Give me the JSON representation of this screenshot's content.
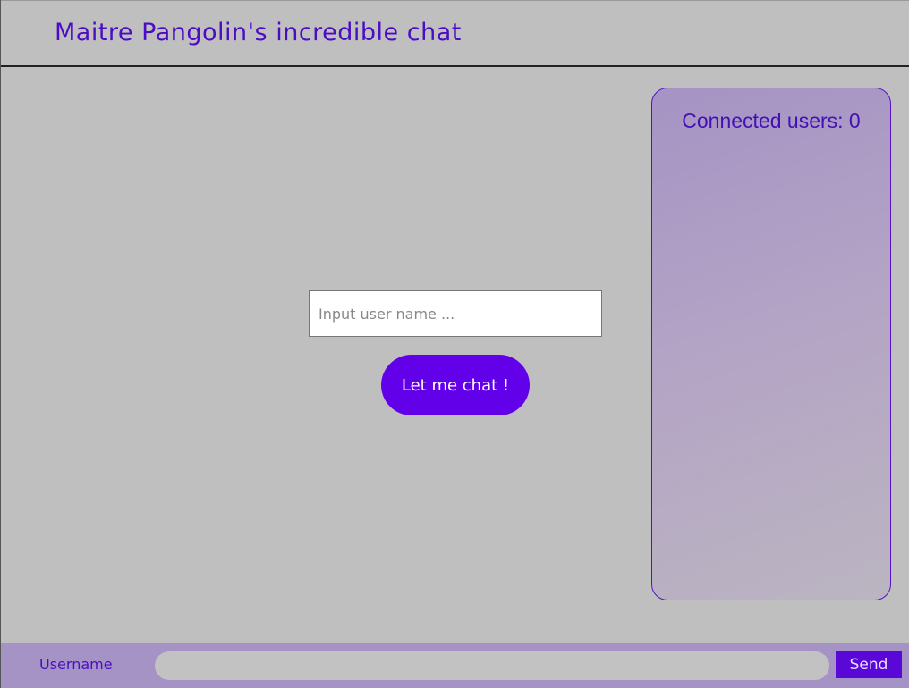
{
  "header": {
    "title": "Maitre Pangolin's incredible chat"
  },
  "users_panel": {
    "title": "Connected users: 0"
  },
  "login": {
    "username_placeholder": "Input user name ...",
    "chat_button": "Let me chat !"
  },
  "footer": {
    "username": "Username",
    "message_value": "",
    "send_button": "Send"
  },
  "colors": {
    "background": "#bfbfbf",
    "accent": "#6200ea",
    "title_text": "#4b0cc4",
    "footer_bg": "#a593c6"
  }
}
